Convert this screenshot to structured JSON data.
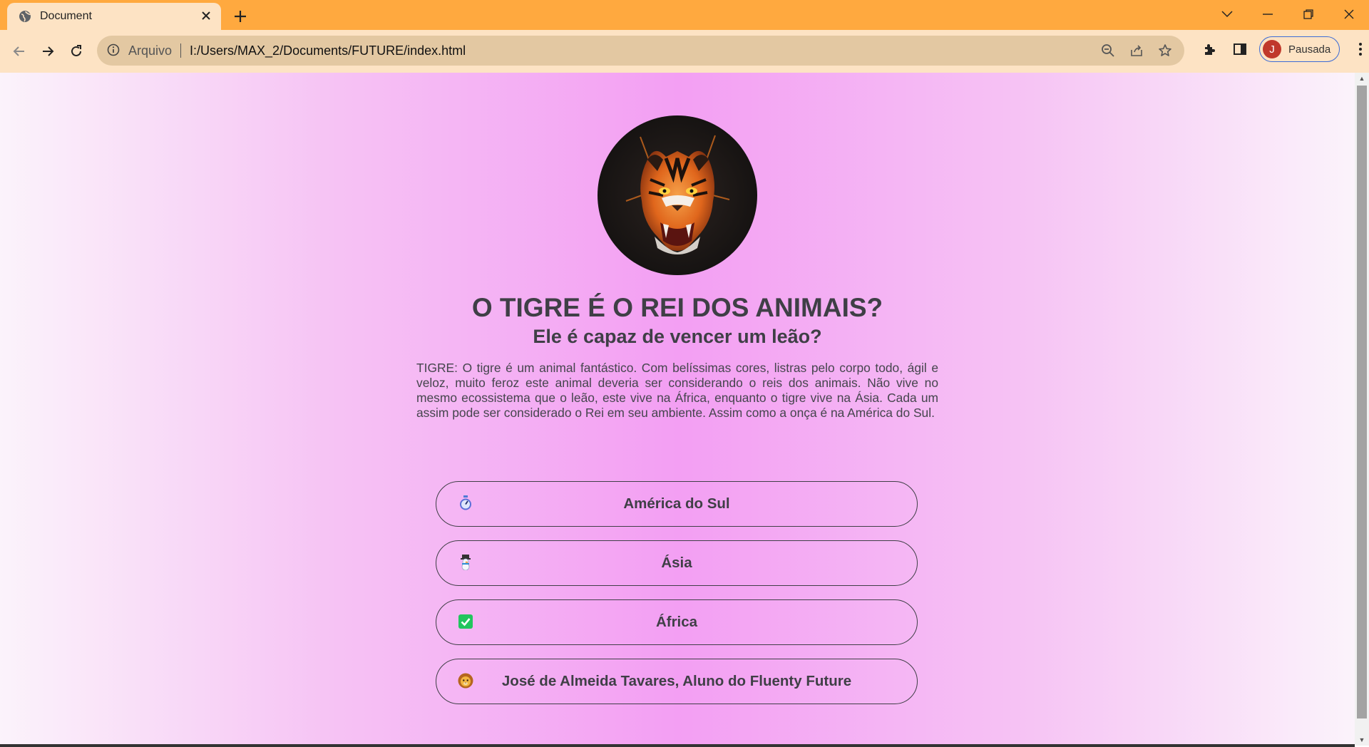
{
  "browser": {
    "tab": {
      "title": "Document",
      "favicon": "globe-icon",
      "close_icon": "close-icon"
    },
    "new_tab_icon": "plus-icon",
    "window_controls": [
      "chevron-down-icon",
      "minimize-icon",
      "restore-icon",
      "close-icon"
    ],
    "nav": [
      "back-arrow-icon",
      "forward-arrow-icon",
      "reload-icon"
    ],
    "address": {
      "scheme_label": "Arquivo",
      "url": "I:/Users/MAX_2/Documents/FUTURE/index.html"
    },
    "omnibox_icons": [
      "zoom-out-icon",
      "share-icon",
      "star-icon"
    ],
    "toolbar_icons": [
      "extensions-icon",
      "side-panel-icon",
      "more-vert-icon"
    ],
    "profile": {
      "initial": "J",
      "status": "Pausada",
      "avatar_color": "#c0382b"
    }
  },
  "page": {
    "image": "tiger-portrait",
    "headline": "O TIGRE É O REI DOS ANIMAIS?",
    "subheadline": "Ele é capaz de vencer um leão?",
    "paragraph": "TIGRE: O tigre é um animal fantástico. Com belíssimas cores, listras pelo corpo todo, ágil e veloz, muito feroz este animal deveria ser considerando o reis dos animais. Não vive no mesmo ecossistema que o leão, este vive na África, enquanto o tigre vive na Ásia. Cada um assim pode ser considerado o Rei em seu ambiente. Assim como a onça é na América do Sul.",
    "options": [
      {
        "label": "América do Sul",
        "icon": "stopwatch-icon"
      },
      {
        "label": "Ásia",
        "icon": "snowman-icon"
      },
      {
        "label": "África",
        "icon": "check-mark-icon"
      },
      {
        "label": "José de Almeida Tavares, Aluno do Fluenty Future",
        "icon": "lion-icon"
      }
    ]
  },
  "colors": {
    "titlebar": "#ffa93f",
    "toolbar": "#fde3c4",
    "page_gradient_center": "#f39ff3",
    "text": "#3f3f46",
    "check_green": "#22c55e"
  }
}
